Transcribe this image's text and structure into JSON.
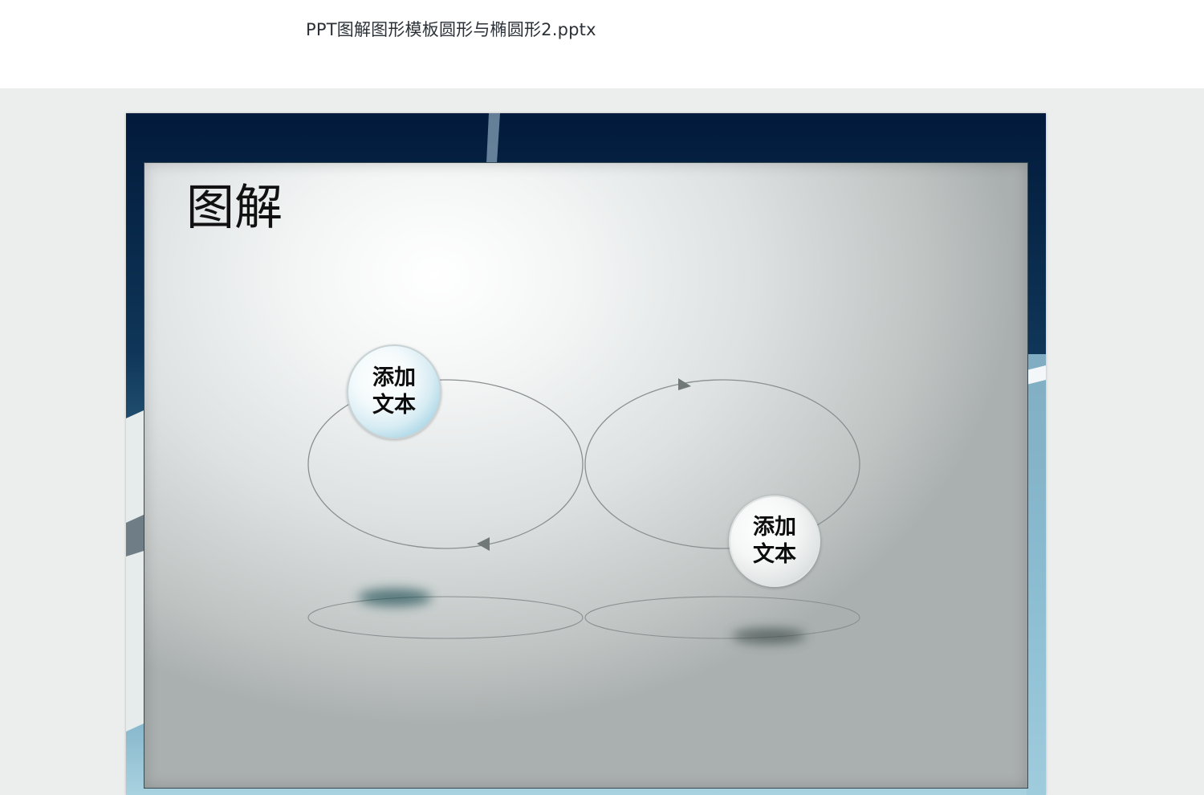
{
  "document": {
    "file_name": "PPT图解图形模板圆形与椭圆形2.pptx"
  },
  "slide": {
    "heading": "图解",
    "bubbles": [
      {
        "label": "添加文本",
        "style": "blue"
      },
      {
        "label": "添加文本",
        "style": "grey"
      }
    ]
  },
  "colors": {
    "frame_background": "#02193a",
    "panel_light": "#f3f5f5",
    "panel_dark": "#aab0af",
    "ellipse_stroke": "#8a8f8f",
    "arrow_fill": "#707878",
    "bubble_blue_edge": "#7fbfd6",
    "shadow_teal": "#2e5a5e"
  }
}
